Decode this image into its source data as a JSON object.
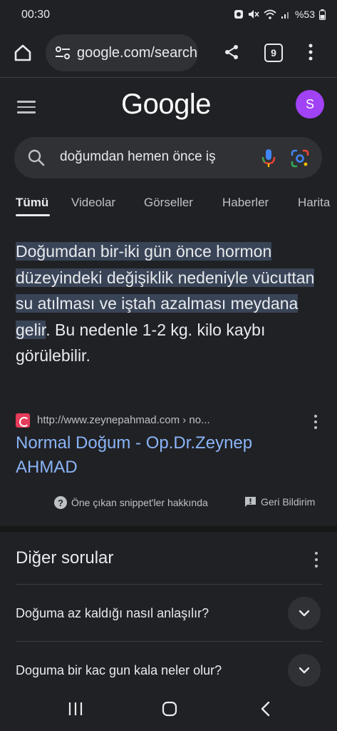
{
  "status_bar": {
    "time": "00:30",
    "battery": "%53",
    "icons": [
      "alarm-icon",
      "mute-icon",
      "wifi-icon",
      "signal-icon",
      "battery-icon"
    ]
  },
  "browser": {
    "url": "google.com/search",
    "tab_count": "9",
    "icons": [
      "home-icon",
      "site-settings-icon",
      "share-icon",
      "tabs-icon",
      "more-vert-icon"
    ]
  },
  "header": {
    "logo_text": "Google",
    "avatar_initial": "S",
    "avatar_color": "#a142f4"
  },
  "search": {
    "query": "doğumdan hemen önce iş"
  },
  "tabs": [
    {
      "label": "Tümü",
      "active": true
    },
    {
      "label": "Videolar",
      "active": false
    },
    {
      "label": "Görseller",
      "active": false
    },
    {
      "label": "Haberler",
      "active": false
    },
    {
      "label": "Harita",
      "active": false
    }
  ],
  "snippet": {
    "highlighted_text": "Doğumdan bir-iki gün önce hormon düzeyindeki değişiklik nedeniyle vücuttan su atılması ve iştah azalması meydana gelir",
    "rest_text": ". Bu nedenle 1-2 kg. kilo kaybı görülebilir.",
    "source_url": "http://www.zeynepahmad.com › no...",
    "result_title": "Normal Doğum - Op.Dr.Zeynep AHMAD",
    "about_label": "Öne çıkan snippet'ler hakkında",
    "feedback_label": "Geri Bildirim"
  },
  "paa": {
    "title": "Diğer sorular",
    "questions": [
      "Doğuma az kaldığı nasıl anlaşılır?",
      "Doguma bir kac gun kala neler olur?"
    ]
  },
  "colors": {
    "background": "#202124",
    "link": "#8ab4f8",
    "highlight": "#394457"
  }
}
